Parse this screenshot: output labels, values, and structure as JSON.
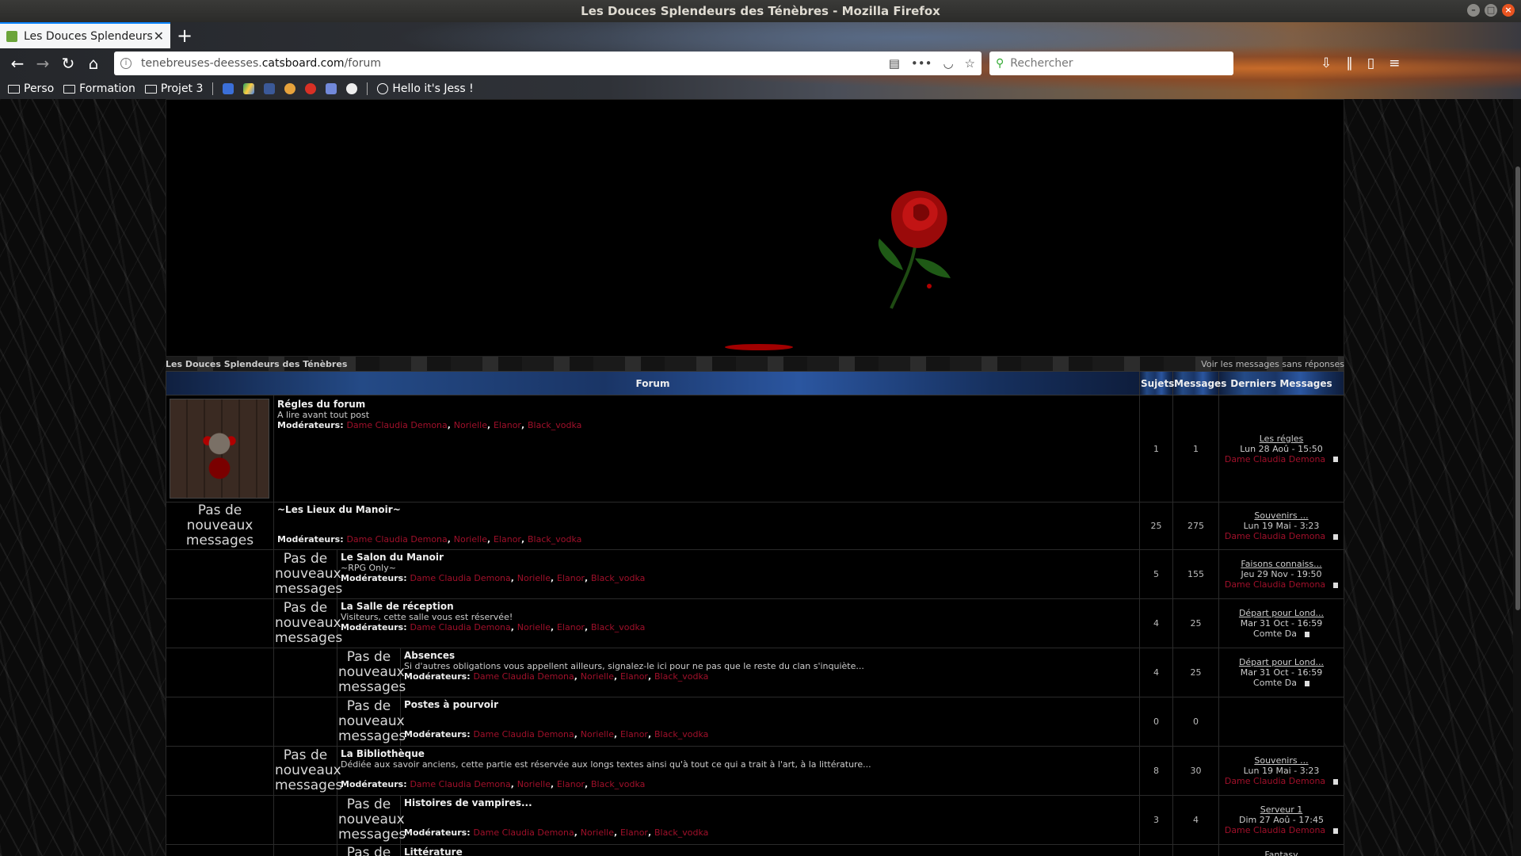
{
  "window": {
    "title": "Les Douces Splendeurs des Ténèbres - Mozilla Firefox"
  },
  "tab": {
    "title": "Les Douces Splendeurs d"
  },
  "url": {
    "pre": "tenebreuses-deesses.",
    "host": "catsboard.com",
    "path": "/forum"
  },
  "search": {
    "placeholder": "Rechercher"
  },
  "bookmarks": [
    {
      "label": "Perso"
    },
    {
      "label": "Formation"
    },
    {
      "label": "Projet 3"
    }
  ],
  "bookmark_hello": "Hello it's Jess !",
  "breadcrumb": {
    "left": "Les Douces Splendeurs des Ténèbres",
    "right": "Voir les messages sans réponses"
  },
  "headers": {
    "forum": "Forum",
    "topics": "Sujets",
    "messages": "Messages",
    "last": "Derniers Messages"
  },
  "no_new": "Pas de nouveaux messages",
  "mods_label": "Modérateurs:",
  "moderators": [
    "Dame Claudia Demona",
    "Norielle",
    "Elanor",
    "Black_vodka"
  ],
  "colors": {
    "moderator": "#a0102a",
    "header_blue": "#244a86"
  },
  "forums": [
    {
      "name": "Régles du forum",
      "desc": "A lire avant tout post",
      "topics": "1",
      "messages": "1",
      "last": {
        "title": "Les régles",
        "date": "Lun 28 Aoû - 15:50",
        "author": "Dame Claudia Demona"
      }
    },
    {
      "name": "~Les Lieux du Manoir~",
      "desc": "",
      "topics": "25",
      "messages": "275",
      "last": {
        "title": "Souvenirs ...",
        "date": "Lun 19 Mai - 3:23",
        "author": "Dame Claudia Demona"
      }
    },
    {
      "name": "Le Salon du Manoir",
      "desc": "~RPG Only~",
      "topics": "5",
      "messages": "155",
      "last": {
        "title": "Faisons connaiss...",
        "date": "Jeu 29 Nov - 19:50",
        "author": "Dame Claudia Demona"
      }
    },
    {
      "name": "La Salle de réception",
      "desc": "Visiteurs, cette salle vous est réservée!",
      "topics": "4",
      "messages": "25",
      "last": {
        "title": "Départ pour Lond...",
        "date": "Mar 31 Oct - 16:59",
        "author": "Comte Da"
      }
    },
    {
      "name": "Absences",
      "desc": "Si d'autres obligations vous appellent ailleurs, signalez-le ici pour ne pas que le reste du clan s'inquiète...",
      "topics": "4",
      "messages": "25",
      "last": {
        "title": "Départ pour Lond...",
        "date": "Mar 31 Oct - 16:59",
        "author": "Comte Da"
      }
    },
    {
      "name": "Postes à pourvoir",
      "desc": "",
      "topics": "0",
      "messages": "0"
    },
    {
      "name": "La Bibliothèque",
      "desc": "Dédiée aux savoir anciens, cette partie est réservée aux longs textes ainsi qu'à tout ce qui a trait à l'art, à la littérature...",
      "topics": "8",
      "messages": "30",
      "last": {
        "title": "Souvenirs ...",
        "date": "Lun 19 Mai - 3:23",
        "author": "Dame Claudia Demona"
      }
    },
    {
      "name": "Histoires de vampires...",
      "desc": "",
      "topics": "3",
      "messages": "4",
      "last": {
        "title": "Serveur 1",
        "date": "Dim 27 Aoû - 17:45",
        "author": "Dame Claudia Demona"
      }
    },
    {
      "name": "Littérature",
      "last": {
        "title": "Fantasy"
      }
    }
  ]
}
